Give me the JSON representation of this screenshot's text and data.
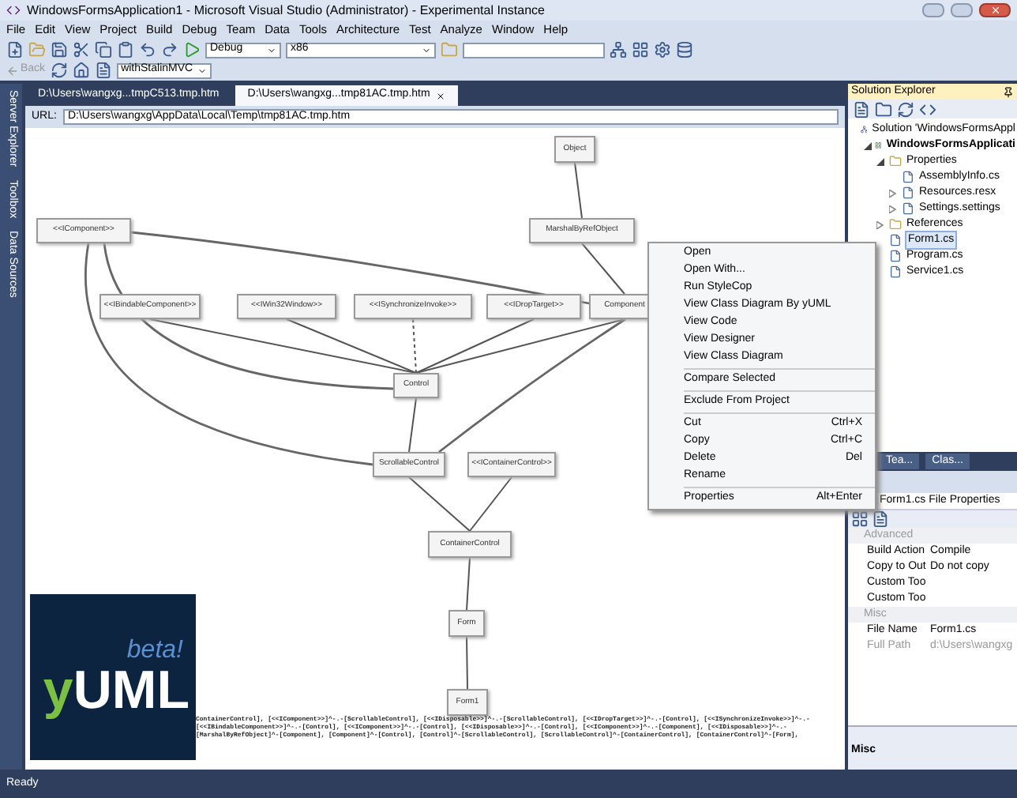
{
  "window": {
    "title": "WindowsFormsApplication1 - Microsoft Visual Studio (Administrator) - Experimental Instance"
  },
  "menu": [
    "File",
    "Edit",
    "View",
    "Project",
    "Build",
    "Debug",
    "Team",
    "Data",
    "Tools",
    "Architecture",
    "Test",
    "Analyze",
    "Window",
    "Help"
  ],
  "toolbar": {
    "configuration": "Debug",
    "platform": "x86",
    "back": "Back",
    "stylesheet": "withStalinMVC"
  },
  "side_tabs": [
    "Server Explorer",
    "Toolbox",
    "Data Sources"
  ],
  "document_tabs": [
    {
      "label": "D:\\Users\\wangxg...tmpC513.tmp.htm",
      "selected": false
    },
    {
      "label": "D:\\Users\\wangxg...tmp81AC.tmp.htm",
      "selected": true
    }
  ],
  "url": {
    "label": "URL:",
    "value": "D:\\Users\\wangxg\\AppData\\Local\\Temp\\tmp81AC.tmp.htm"
  },
  "diagram": {
    "nodes": [
      "Object",
      "<<IComponent>>",
      "MarshalByRefObject",
      "<<IBindableComponent>>",
      "<<IWin32Window>>",
      "<<ISynchronizeInvoke>>",
      "<<IDropTarget>>",
      "Component",
      "Control",
      "ScrollableControl",
      "<<IContainerControl>>",
      "ContainerControl",
      "Form",
      "Form1"
    ]
  },
  "logo": {
    "text": "yUML",
    "badge": "beta!"
  },
  "yuml_source": [
    "ContainerControl], [<<IComponent>>]^-.-[ScrollableControl], [<<IDisposable>>]^-.-[ScrollableControl], [<<IDropTarget>>]^-.-[Control], [<<ISynchronizeInvoke>>]^-.-",
    "[<<IBindableComponent>>]^-.-[Control], [<<IComponent>>]^-.-[Control], [<<IDisposable>>]^-.-[Control], [<<IComponent>>]^-.-[Component], [<<IDisposable>>]^-.-",
    "[MarshalByRefObject]^-[Component], [Component]^-[Control], [Control]^-[ScrollableControl], [ScrollableControl]^-[ContainerControl], [ContainerControl]^-[Form],"
  ],
  "context_menu": [
    {
      "kind": "item",
      "label": "Open"
    },
    {
      "kind": "item",
      "label": "Open With..."
    },
    {
      "kind": "item",
      "label": "Run StyleCop"
    },
    {
      "kind": "item",
      "label": "View Class Diagram By yUML"
    },
    {
      "kind": "item",
      "label": "View Code"
    },
    {
      "kind": "item",
      "label": "View Designer"
    },
    {
      "kind": "item",
      "label": "View Class Diagram"
    },
    {
      "kind": "separator"
    },
    {
      "kind": "item",
      "label": "Compare Selected"
    },
    {
      "kind": "separator"
    },
    {
      "kind": "item",
      "label": "Exclude From Project"
    },
    {
      "kind": "separator"
    },
    {
      "kind": "item",
      "label": "Cut",
      "shortcut": "Ctrl+X"
    },
    {
      "kind": "item",
      "label": "Copy",
      "shortcut": "Ctrl+C"
    },
    {
      "kind": "item",
      "label": "Delete",
      "shortcut": "Del"
    },
    {
      "kind": "item",
      "label": "Rename"
    },
    {
      "kind": "separator"
    },
    {
      "kind": "item",
      "label": "Properties",
      "shortcut": "Alt+Enter"
    }
  ],
  "solution_explorer": {
    "title": "Solution Explorer",
    "tree": [
      {
        "label": "Solution 'WindowsFormsAppl",
        "kind": "solution",
        "selected": false,
        "children": [
          {
            "label": "WindowsFormsApplicati",
            "kind": "project",
            "selected": false,
            "expanded": true,
            "children": [
              {
                "label": "Properties",
                "kind": "folder",
                "selected": false,
                "expanded": true,
                "children": [
                  {
                    "label": "AssemblyInfo.cs",
                    "kind": "file",
                    "selected": false
                  },
                  {
                    "label": "Resources.resx",
                    "kind": "file",
                    "selected": false,
                    "expanded": false
                  },
                  {
                    "label": "Settings.settings",
                    "kind": "file",
                    "selected": false,
                    "expanded": false
                  }
                ]
              },
              {
                "label": "References",
                "kind": "folder",
                "selected": false,
                "expanded": false
              },
              {
                "label": "Form1.cs",
                "kind": "file",
                "selected": true
              },
              {
                "label": "Program.cs",
                "kind": "file",
                "selected": false
              },
              {
                "label": "Service1.cs",
                "kind": "file",
                "selected": false
              }
            ]
          }
        ]
      }
    ]
  },
  "panel_tabs": [
    "Tea...",
    "Clas..."
  ],
  "properties": {
    "object": "Form1.cs File Properties",
    "categories": [
      {
        "name": "Advanced",
        "rows": [
          {
            "name": "Build Action",
            "value": "Compile",
            "disabled": false
          },
          {
            "name": "Copy to Out",
            "value": "Do not copy",
            "disabled": false
          },
          {
            "name": "Custom Too",
            "disabled": false
          },
          {
            "name": "Custom Too",
            "disabled": false
          }
        ]
      },
      {
        "name": "Misc",
        "rows": [
          {
            "name": "File Name",
            "value": "Form1.cs",
            "disabled": false
          },
          {
            "name": "Full Path",
            "value": "d:\\Users\\wangxg",
            "disabled": true
          }
        ]
      }
    ],
    "description": "Misc"
  },
  "status_bar": "Ready"
}
